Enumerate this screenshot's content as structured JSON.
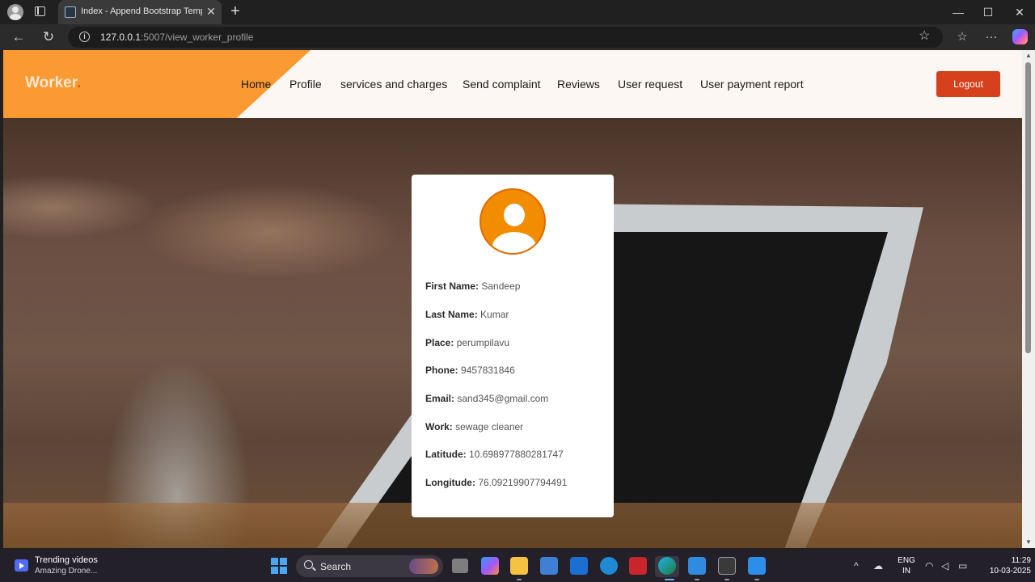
{
  "browser": {
    "tab_title": "Index - Append Bootstrap Templa",
    "tab_close": "✕",
    "new_tab": "+",
    "url_host": "127.0.0.1",
    "url_path": ":5007/view_worker_profile",
    "window_controls": {
      "minimize": "—",
      "maximize": "☐",
      "close": "✕"
    },
    "nav": {
      "back": "←",
      "reload": "↻",
      "star": "☆",
      "favorites": "☆",
      "more": "···"
    }
  },
  "site": {
    "brand": "Worker",
    "brand_dot": ".",
    "nav": [
      {
        "label": "Home"
      },
      {
        "label": "Profile"
      },
      {
        "label": "services and charges"
      },
      {
        "label": "Send complaint"
      },
      {
        "label": "Reviews"
      },
      {
        "label": "User request"
      },
      {
        "label": "User payment report"
      }
    ],
    "logout_label": "Logout",
    "colors": {
      "brand": "#fb9a33",
      "logout": "#d6401c",
      "avatar": "#f28c00"
    }
  },
  "profile": {
    "fields": [
      {
        "label": "First Name:",
        "value": "Sandeep"
      },
      {
        "label": "Last Name:",
        "value": "Kumar"
      },
      {
        "label": "Place:",
        "value": "perumpilavu"
      },
      {
        "label": "Phone:",
        "value": "9457831846"
      },
      {
        "label": "Email:",
        "value": "sand345@gmail.com"
      },
      {
        "label": "Work:",
        "value": "sewage cleaner"
      },
      {
        "label": "Latitude:",
        "value": "10.698977880281747"
      },
      {
        "label": "Longitude:",
        "value": "76.09219907794491"
      }
    ]
  },
  "taskbar": {
    "widget_title": "Trending videos",
    "widget_subtitle": "Amazing Drone...",
    "search_placeholder": "Search",
    "lang_top": "ENG",
    "lang_bottom": "IN",
    "time": "11:29",
    "date": "10-03-2025"
  }
}
